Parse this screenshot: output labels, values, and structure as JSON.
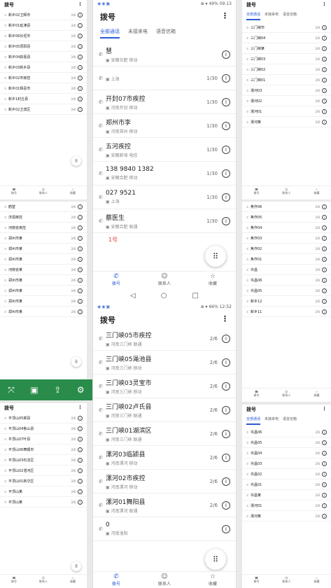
{
  "main_top": {
    "status": {
      "icons": "◉◉▣",
      "right": "⊕ ▾ 49% 09:13"
    },
    "title": "拨号",
    "tabs": [
      "全部通话",
      "未接来电",
      "语音信箱"
    ],
    "rows": [
      {
        "name": "慧",
        "sub": "安徽合肥 移动",
        "count": ""
      },
      {
        "name": "",
        "sub": "上海",
        "count": "1/30"
      },
      {
        "name": "开封07市疾控",
        "sub": "河南开封 移动",
        "count": "1/30"
      },
      {
        "name": "郑州市李",
        "sub": "河南郑州 移动",
        "count": "1/30"
      },
      {
        "name": "五河疾控",
        "sub": "安徽蚌埠 电信",
        "count": "1/30"
      },
      {
        "name": "138 9840 1382",
        "sub": "安徽合肥 移动",
        "count": "1/30"
      },
      {
        "name": "027 9521",
        "sub": "上海",
        "count": "1/30"
      },
      {
        "name": "蔡医生",
        "sub": "安徽合肥 联通",
        "count": "1/30"
      }
    ],
    "red_label": "1号",
    "nav": [
      "拨号",
      "联系人",
      "收藏"
    ]
  },
  "main_bottom": {
    "status": {
      "right": "⊕ ▾ 66% 12:52"
    },
    "title": "拨号",
    "rows": [
      {
        "name": "三门峡05市疾控",
        "sub": "河南三门峡 联通",
        "count": "2/6"
      },
      {
        "name": "三门峡05渑池县",
        "sub": "河南三门峡 移动",
        "count": "2/6"
      },
      {
        "name": "三门峡03灵宝市",
        "sub": "河南三门峡 移动",
        "count": "2/6"
      },
      {
        "name": "三门峡02卢氏县",
        "sub": "河南三门峡 联通",
        "count": "2/6"
      },
      {
        "name": "三门峡01湖滨区",
        "sub": "河南三门峡 联通",
        "count": "2/6"
      },
      {
        "name": "漯河03临颍县",
        "sub": "河南漯河 移动",
        "count": "2/6"
      },
      {
        "name": "漯河02市疾控",
        "sub": "河南漯河 移动",
        "count": "2/6"
      },
      {
        "name": "漯河01舞阳县",
        "sub": "河南漯河 联通",
        "count": "2/6"
      },
      {
        "name": "0",
        "sub": "河南洛阳",
        "count": ""
      }
    ],
    "nav": [
      "拨号",
      "联系人",
      "收藏"
    ]
  },
  "thumb_left": {
    "title": "拨号",
    "rows_a": [
      "新乡02卫辉市",
      "新乡01延津县",
      "新乡06长垣市",
      "新乡05原阳县",
      "新乡04获嘉县",
      "新乡03新乡县",
      "新乡02市疾控",
      "新乡01辉县市",
      "新乡1封丘县",
      "新乡02卫滨区"
    ],
    "rows_b": [
      "鹤壁",
      "济源疾控",
      "河南省疾控",
      "郑州市某",
      "郑州市某",
      "郑州市某",
      "河南省某",
      "郑州市某",
      "郑州市某",
      "郑州市某",
      "郑州市某"
    ],
    "rows_c": [
      "平顶山05郏县",
      "平顶山04鲁山县",
      "平顶山07叶县",
      "平顶山06舞钢市",
      "平顶山03石龙区",
      "平顶山02湛河区",
      "平顶山01新华区",
      "平顶山某",
      "平顶山某"
    ],
    "count": "2/6",
    "nav": [
      "拨号",
      "联系人",
      "收藏"
    ]
  },
  "thumb_right": {
    "title": "拨号",
    "tabs": [
      "全部通话",
      "未接来电",
      "语音信箱"
    ],
    "rows_a": [
      "三门峡市",
      "三门峡04",
      "三门峡某",
      "三门峡03",
      "三门峡02",
      "三门峡01",
      "漯河03",
      "漯河02",
      "漯河01",
      "漯河某"
    ],
    "rows_b": [
      "焦作06",
      "焦作05",
      "焦作04",
      "焦作03",
      "焦作02",
      "焦作01",
      "许昌",
      "许昌06",
      "许昌05",
      "新乡12",
      "新乡11"
    ],
    "rows_c": [
      "许昌06",
      "许昌05",
      "许昌04",
      "许昌03",
      "许昌02",
      "许昌01",
      "许昌某",
      "漯河01",
      "漯河某"
    ],
    "count": "2/6",
    "nav": [
      "拨号",
      "联系人",
      "收藏"
    ]
  },
  "toolbar": [
    "⤧",
    "▣",
    "⇪",
    "⚙"
  ]
}
